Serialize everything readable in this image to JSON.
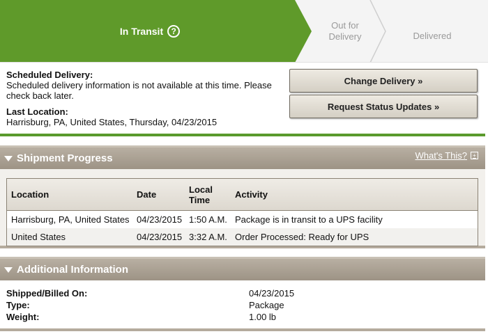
{
  "progress": {
    "steps": [
      {
        "label": "In Transit",
        "state": "active"
      },
      {
        "label_line1": "Out for",
        "label_line2": "Delivery",
        "state": "pending"
      },
      {
        "label": "Delivered",
        "state": "pending"
      }
    ],
    "help_glyph": "?",
    "colors": {
      "active": "#5f9a2a",
      "pending": "#f4f4f4",
      "pending_text": "#9a9a9a"
    }
  },
  "summary": {
    "scheduled_label": "Scheduled Delivery:",
    "scheduled_text": "Scheduled delivery information is not available at this time. Please check back later.",
    "last_location_label": "Last Location:",
    "last_location_text": "Harrisburg, PA, United States, Thursday, 04/23/2015",
    "buttons": {
      "change_delivery": "Change Delivery »",
      "request_updates": "Request Status Updates »"
    }
  },
  "shipment_progress": {
    "title": "Shipment Progress",
    "whats_this": "What's This?",
    "columns": {
      "location": "Location",
      "date": "Date",
      "time_line1": "Local",
      "time_line2": "Time",
      "activity": "Activity"
    },
    "rows": [
      {
        "location": "Harrisburg, PA, United States",
        "date": "04/23/2015",
        "time": "1:50 A.M.",
        "activity": "Package is in transit to a UPS facility"
      },
      {
        "location": "United States",
        "date": "04/23/2015",
        "time": "3:32 A.M.",
        "activity": "Order Processed: Ready for UPS"
      }
    ]
  },
  "additional_info": {
    "title": "Additional Information",
    "items": [
      {
        "key": "Shipped/Billed On:",
        "value": "04/23/2015"
      },
      {
        "key": "Type:",
        "value": "Package"
      },
      {
        "key": "Weight:",
        "value": "1.00 lb"
      }
    ]
  }
}
